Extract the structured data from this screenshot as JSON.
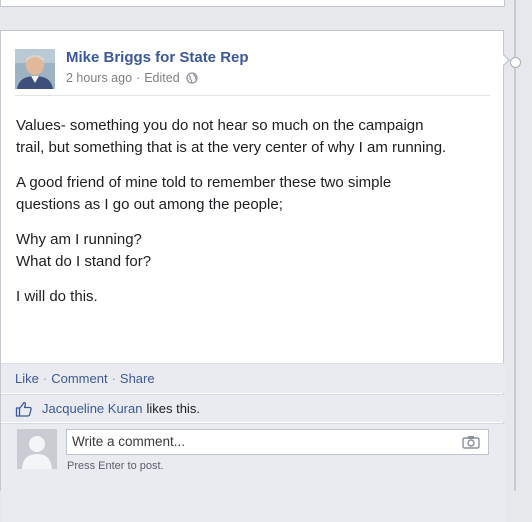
{
  "post": {
    "author": "Mike Briggs for State Rep",
    "time": "2 hours ago",
    "separator": "·",
    "edited": "Edited",
    "privacy_icon": "globe-icon",
    "paragraphs": [
      [
        "Values- something you do not hear so much on the campaign",
        "trail, but something that is at the very center of why I am running."
      ],
      [
        "A good friend of mine told to remember these two simple",
        "questions as I go out among the people;"
      ],
      [
        "Why am I running?",
        "What do I stand for?"
      ],
      [
        "I will do this."
      ]
    ]
  },
  "actions": {
    "like": "Like",
    "comment": "Comment",
    "share": "Share",
    "separator": "·"
  },
  "likes": {
    "icon": "thumbs-up-icon",
    "liker": "Jacqueline Kuran",
    "text": "likes this."
  },
  "comment": {
    "placeholder": "Write a comment...",
    "hint": "Press Enter to post.",
    "camera_icon": "camera-icon"
  },
  "colors": {
    "link": "#3b5998",
    "background": "#e6e8ec",
    "bar": "#e9ebf0"
  }
}
